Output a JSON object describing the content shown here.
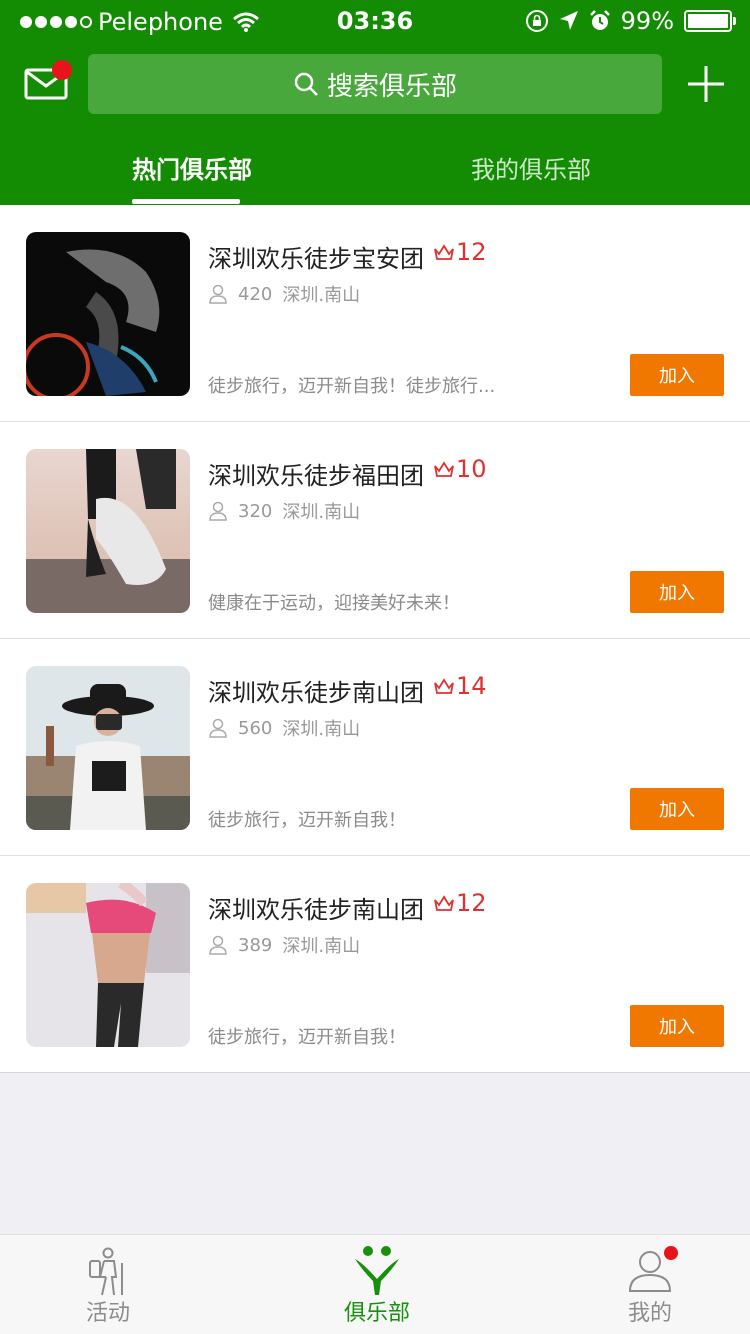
{
  "status_bar": {
    "carrier": "Pelephone",
    "time": "03:36",
    "battery": "99%",
    "battery_level": 0.99
  },
  "header": {
    "search_placeholder": "搜索俱乐部",
    "tabs": [
      {
        "label": "热门俱乐部",
        "active": true
      },
      {
        "label": "我的俱乐部",
        "active": false
      }
    ]
  },
  "clubs": [
    {
      "name": "深圳欢乐徒步宝安团",
      "level": "12",
      "members": "420",
      "location": "深圳.南山",
      "desc": "徒步旅行，迈开新自我！徒步旅行...",
      "join_label": "加入"
    },
    {
      "name": "深圳欢乐徒步福田团",
      "level": "10",
      "members": "320",
      "location": "深圳.南山",
      "desc": "健康在于运动，迎接美好未来！",
      "join_label": "加入"
    },
    {
      "name": "深圳欢乐徒步南山团",
      "level": "14",
      "members": "560",
      "location": "深圳.南山",
      "desc": "徒步旅行，迈开新自我！",
      "join_label": "加入"
    },
    {
      "name": "深圳欢乐徒步南山团",
      "level": "12",
      "members": "389",
      "location": "深圳.南山",
      "desc": "徒步旅行，迈开新自我！",
      "join_label": "加入"
    }
  ],
  "tabbar": {
    "items": [
      {
        "label": "活动",
        "icon": "hiker-icon",
        "active": false
      },
      {
        "label": "俱乐部",
        "icon": "club-icon",
        "active": true
      },
      {
        "label": "我的",
        "icon": "profile-icon",
        "active": false,
        "badge": true
      }
    ]
  },
  "colors": {
    "brand_green": "#138c04",
    "search_bg": "#48a83c",
    "join_orange": "#f07800",
    "level_red": "#e03030",
    "badge_red": "#e8141c"
  }
}
